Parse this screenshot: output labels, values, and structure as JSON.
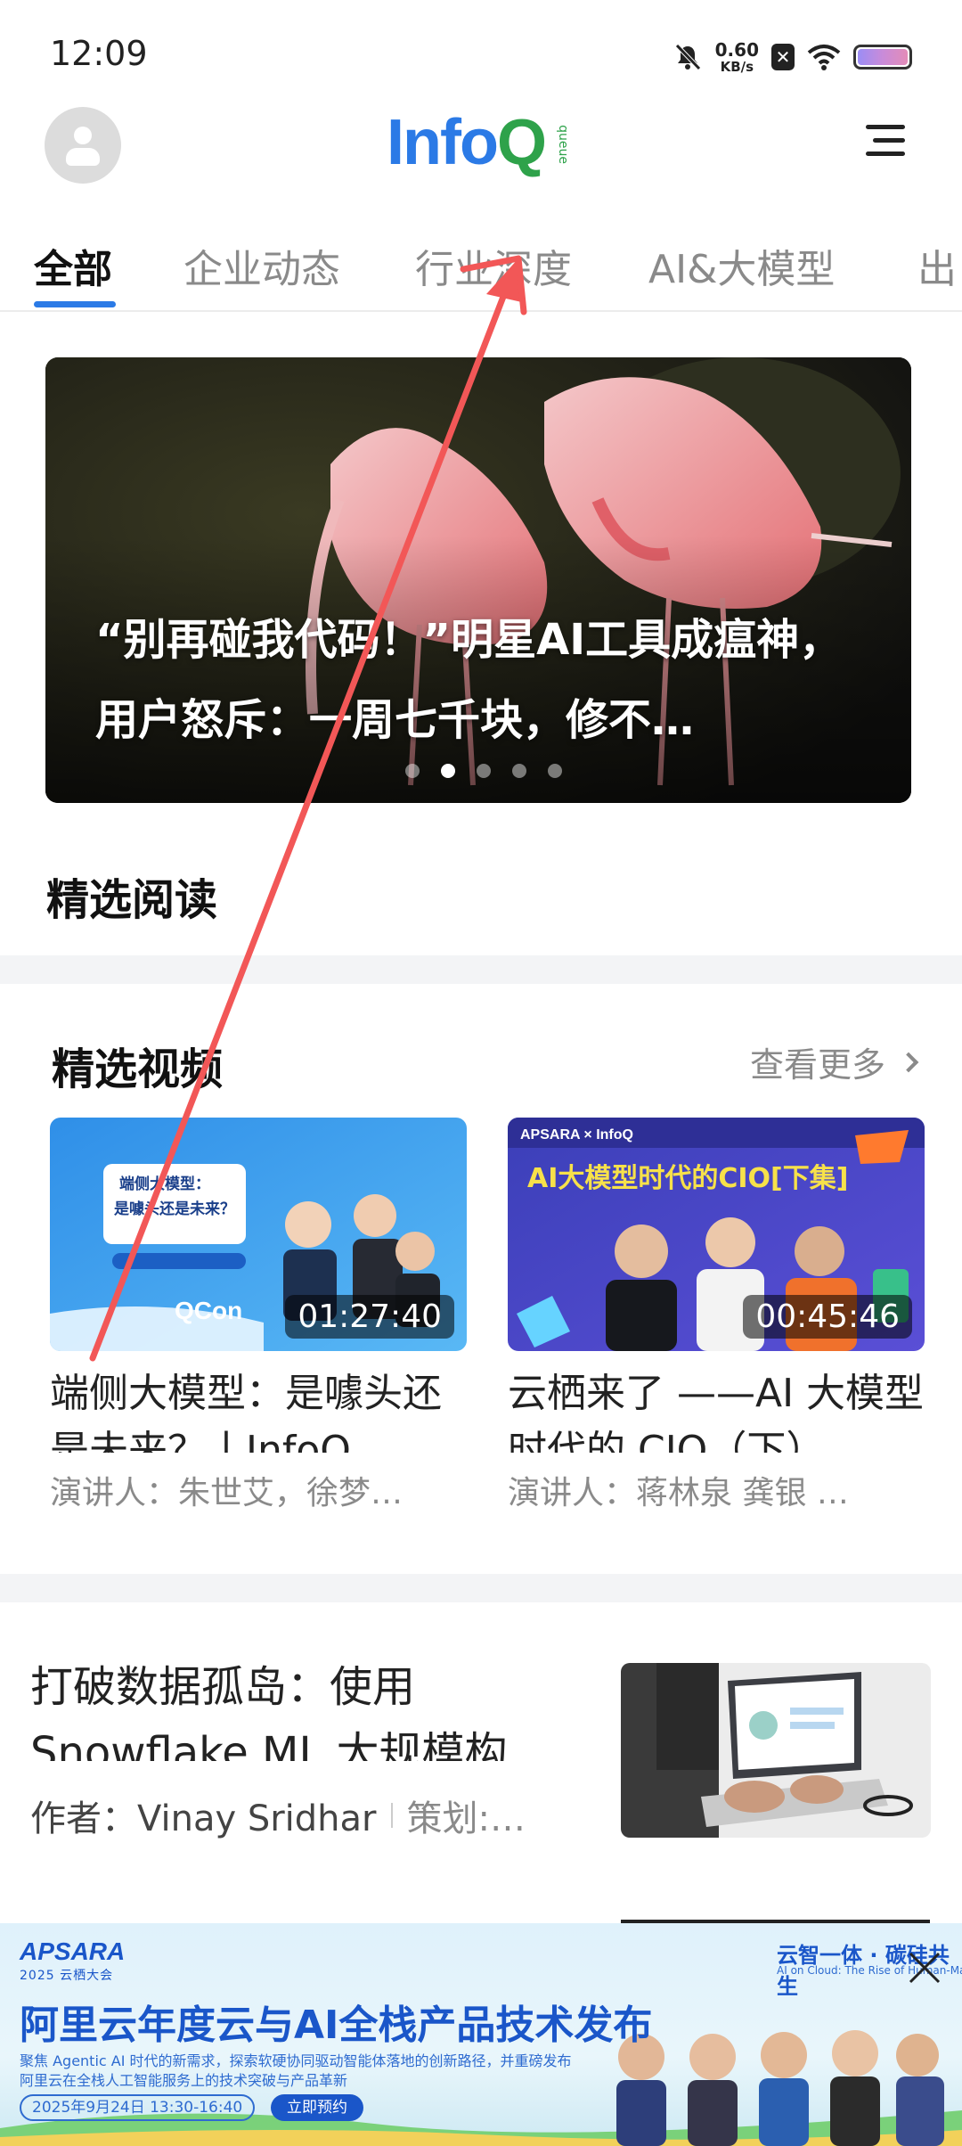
{
  "status_bar": {
    "time": "12:09",
    "net_speed_value": "0.60",
    "net_speed_unit": "KB/s",
    "icons": [
      "mute-bell-icon",
      "sim-x-icon",
      "wifi-icon",
      "battery-icon"
    ]
  },
  "header": {
    "logo_main": "Info",
    "logo_q": "Q",
    "logo_sub": "queue",
    "menu_icon": "hamburger-menu-icon"
  },
  "tabs": [
    "全部",
    "企业动态",
    "行业深度",
    "AI&大模型",
    "出"
  ],
  "active_tab": "全部",
  "banner": {
    "title": "“别再碰我代码！”明星AI工具成瘟神，用户怒斥：一周七千块，修不…",
    "slide_count": 5,
    "active_slide": 2
  },
  "featured_reading": {
    "title": "精选阅读"
  },
  "featured_video": {
    "title": "精选视频",
    "see_more": "查看更多",
    "items": [
      {
        "title": "端侧大模型：是噱头还是未来？丨InfoQ…",
        "duration": "01:27:40",
        "speaker": "演讲人：朱世艾，徐梦…",
        "thumb_text": "端侧大模型：是噱头还是未来？",
        "thumb_brand": "QCon"
      },
      {
        "title": "云栖来了 ——AI 大模型时代的 CIO（下）",
        "duration": "00:45:46",
        "speaker": "演讲人：蒋林泉 龚银 …",
        "thumb_text": "AI大模型时代的CIO[下集]",
        "thumb_brand": "APSARA × InfoQ"
      }
    ]
  },
  "article": {
    "title": "打破数据孤岛：使用 Snowflake ML 大规模构建、部…",
    "author": "作者：Vinay Sridhar",
    "editor": "策划:…"
  },
  "ad": {
    "brand": "APSARA",
    "brand_sub": "2025 云栖大会",
    "title": "阿里云年度云与AI全栈产品技术发布",
    "desc_line1": "聚焦 Agentic AI 时代的新需求，探索软硬协同驱动智能体落地的创新路径，并重磅发布",
    "desc_line2": "阿里云在全栈人工智能服务上的技术突破与产品革新",
    "date": "2025年9月24日 13:30-16:40",
    "cta": "立即预约",
    "slogan": "云智一体 · 碳硅共生",
    "slogan_sub": "AI on Cloud: The Rise of Human-Machine Symbiosis",
    "close_icon": "close-icon"
  },
  "colors": {
    "accent": "#2b7ae6",
    "logo_green": "#2ea24a",
    "annotation_arrow": "#f25757"
  }
}
